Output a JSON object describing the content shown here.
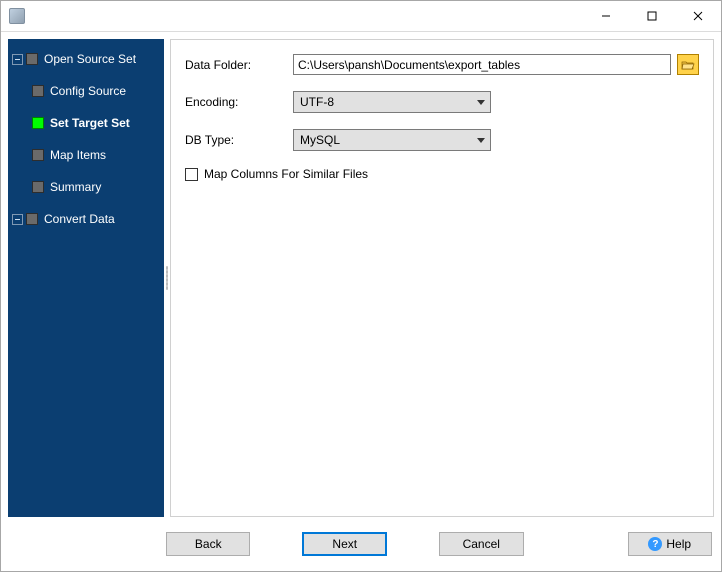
{
  "window": {
    "title": ""
  },
  "sidebar": {
    "items": [
      {
        "label": "Open Source Set",
        "level": 0,
        "expander": true,
        "active": false
      },
      {
        "label": "Config Source",
        "level": 1,
        "expander": false,
        "active": false
      },
      {
        "label": "Set Target Set",
        "level": 1,
        "expander": false,
        "active": true
      },
      {
        "label": "Map Items",
        "level": 1,
        "expander": false,
        "active": false
      },
      {
        "label": "Summary",
        "level": 1,
        "expander": false,
        "active": false
      },
      {
        "label": "Convert Data",
        "level": 0,
        "expander": true,
        "active": false
      }
    ]
  },
  "form": {
    "data_folder_label": "Data Folder:",
    "data_folder_value": "C:\\Users\\pansh\\Documents\\export_tables",
    "encoding_label": "Encoding:",
    "encoding_value": "UTF-8",
    "dbtype_label": "DB Type:",
    "dbtype_value": "MySQL",
    "map_columns_label": "Map Columns For Similar Files",
    "map_columns_checked": false
  },
  "buttons": {
    "back": "Back",
    "next": "Next",
    "cancel": "Cancel",
    "help": "Help"
  }
}
